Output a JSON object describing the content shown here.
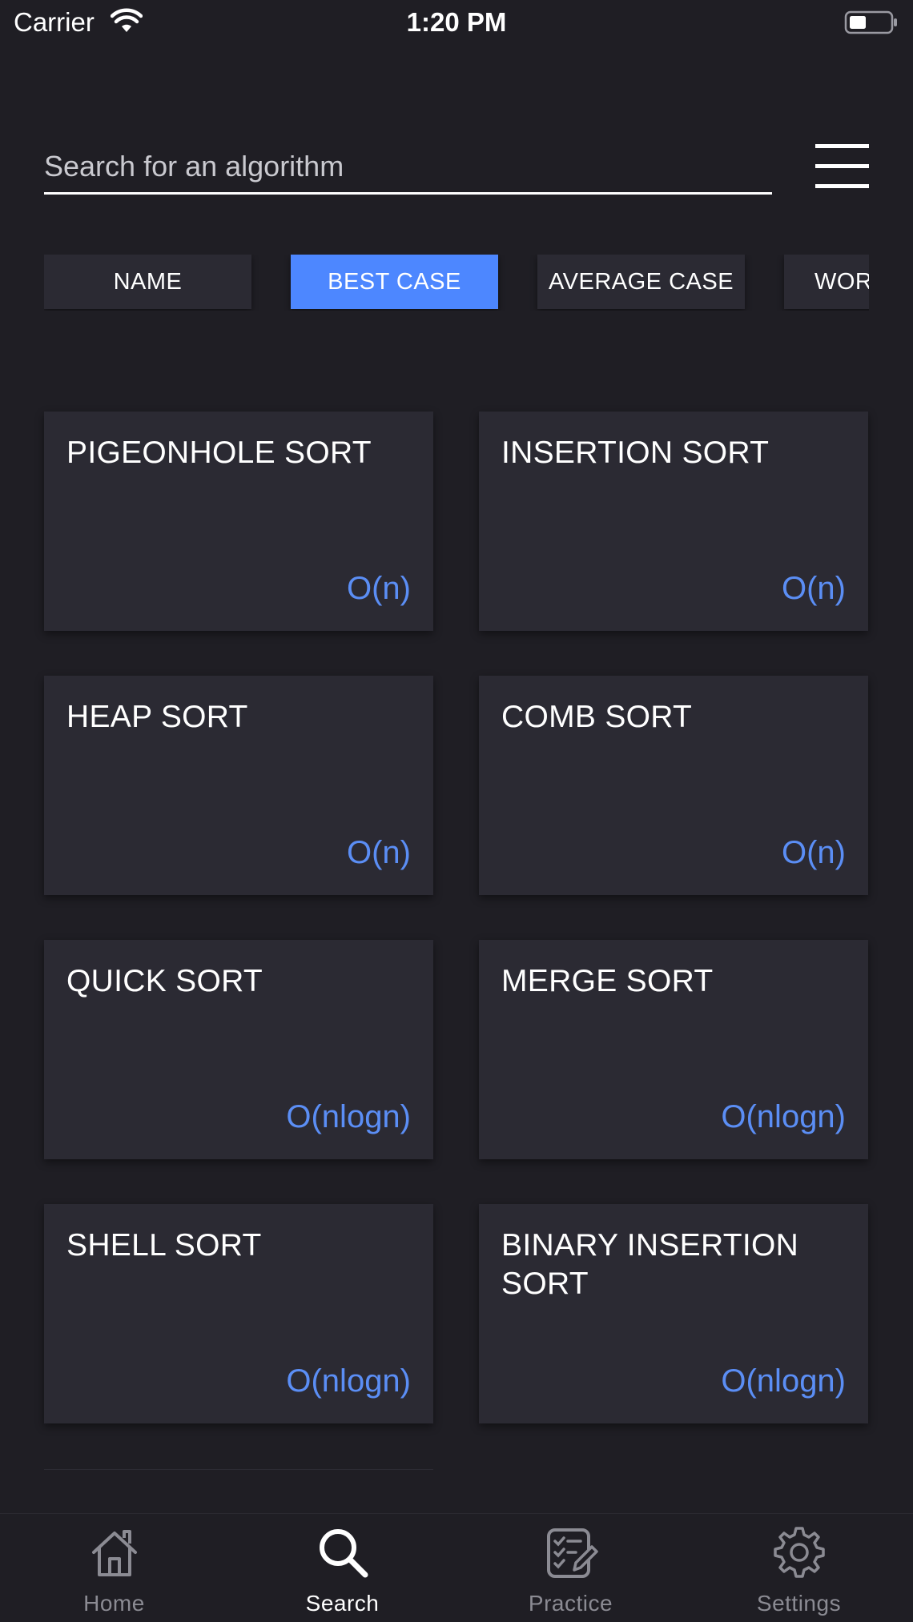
{
  "status_bar": {
    "carrier": "Carrier",
    "time": "1:20 PM"
  },
  "search": {
    "placeholder": "Search for an algorithm",
    "value": ""
  },
  "sort_tabs": [
    {
      "label": "NAME",
      "active": false
    },
    {
      "label": "BEST CASE",
      "active": true
    },
    {
      "label": "AVERAGE CASE",
      "active": false
    },
    {
      "label": "WORST CASE",
      "active": false
    }
  ],
  "algorithms": [
    {
      "name": "PIGEONHOLE SORT",
      "complexity": "O(n)"
    },
    {
      "name": "INSERTION SORT",
      "complexity": "O(n)"
    },
    {
      "name": "HEAP SORT",
      "complexity": "O(n)"
    },
    {
      "name": "COMB SORT",
      "complexity": "O(n)"
    },
    {
      "name": "QUICK SORT",
      "complexity": "O(nlogn)"
    },
    {
      "name": "MERGE SORT",
      "complexity": "O(nlogn)"
    },
    {
      "name": "SHELL SORT",
      "complexity": "O(nlogn)"
    },
    {
      "name": "BINARY INSERTION SORT",
      "complexity": "O(nlogn)"
    }
  ],
  "tabbar": [
    {
      "label": "Home",
      "icon": "home-icon",
      "active": false
    },
    {
      "label": "Search",
      "icon": "search-icon",
      "active": true
    },
    {
      "label": "Practice",
      "icon": "practice-icon",
      "active": false
    },
    {
      "label": "Settings",
      "icon": "gear-icon",
      "active": false
    }
  ],
  "colors": {
    "background": "#1f1e24",
    "card": "#2b2a33",
    "accent": "#4d87ff",
    "complexity_text": "#5b8ef5",
    "inactive_tab_label": "#8b8b93"
  }
}
